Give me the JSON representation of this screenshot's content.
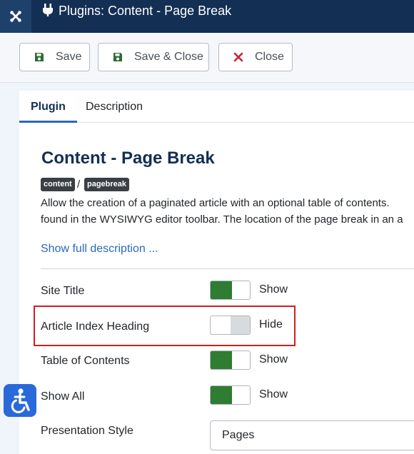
{
  "header": {
    "title": "Plugins: Content - Page Break"
  },
  "toolbar": {
    "save_label": "Save",
    "save_close_label": "Save & Close",
    "close_label": "Close"
  },
  "tabs": [
    {
      "label": "Plugin",
      "active": true
    },
    {
      "label": "Description",
      "active": false
    }
  ],
  "plugin": {
    "title": "Content - Page Break",
    "badges": [
      "content",
      "pagebreak"
    ],
    "badge_separator": "/",
    "description_lines": [
      "Allow the creation of a paginated article with an optional table of contents.",
      "found in the WYSIWYG editor toolbar. The location of the page break in an a"
    ],
    "show_full": "Show full description ..."
  },
  "fields": [
    {
      "label": "Site Title",
      "state": "Show",
      "on": true
    },
    {
      "label": "Article Index Heading",
      "state": "Hide",
      "on": false
    },
    {
      "label": "Table of Contents",
      "state": "Show",
      "on": true
    },
    {
      "label": "Show All",
      "state": "Show",
      "on": true
    }
  ],
  "presentation": {
    "label": "Presentation Style",
    "value": "Pages"
  },
  "colors": {
    "header_bg": "#132f53",
    "toggle_on": "#2e7d32",
    "highlight": "#d01f1f",
    "link": "#2a69b8"
  },
  "icons": [
    "joomla-icon",
    "plug-icon",
    "save-icon",
    "close-icon",
    "accessibility-icon"
  ]
}
